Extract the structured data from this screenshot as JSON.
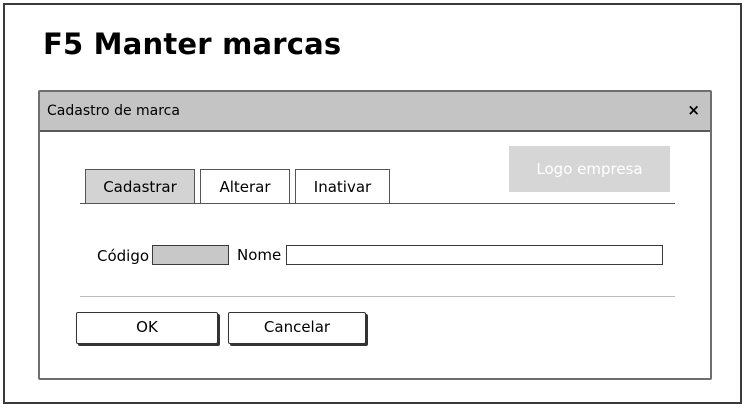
{
  "page": {
    "title": "F5 Manter marcas"
  },
  "dialog": {
    "title": "Cadastro de marca",
    "close_icon": "×",
    "tabs": [
      {
        "label": "Cadastrar",
        "active": true
      },
      {
        "label": "Alterar",
        "active": false
      },
      {
        "label": "Inativar",
        "active": false
      }
    ],
    "logo_button": "Logo empresa",
    "form": {
      "code_label": "Código",
      "code_value": "",
      "name_label": "Nome",
      "name_value": ""
    },
    "buttons": {
      "ok": "OK",
      "cancel": "Cancelar"
    }
  },
  "colors": {
    "header_bg": "#c4c4c4",
    "active_tab_bg": "#d3d3d3",
    "logo_bg": "#d6d6d6",
    "code_field_bg": "#c8c8c8"
  }
}
